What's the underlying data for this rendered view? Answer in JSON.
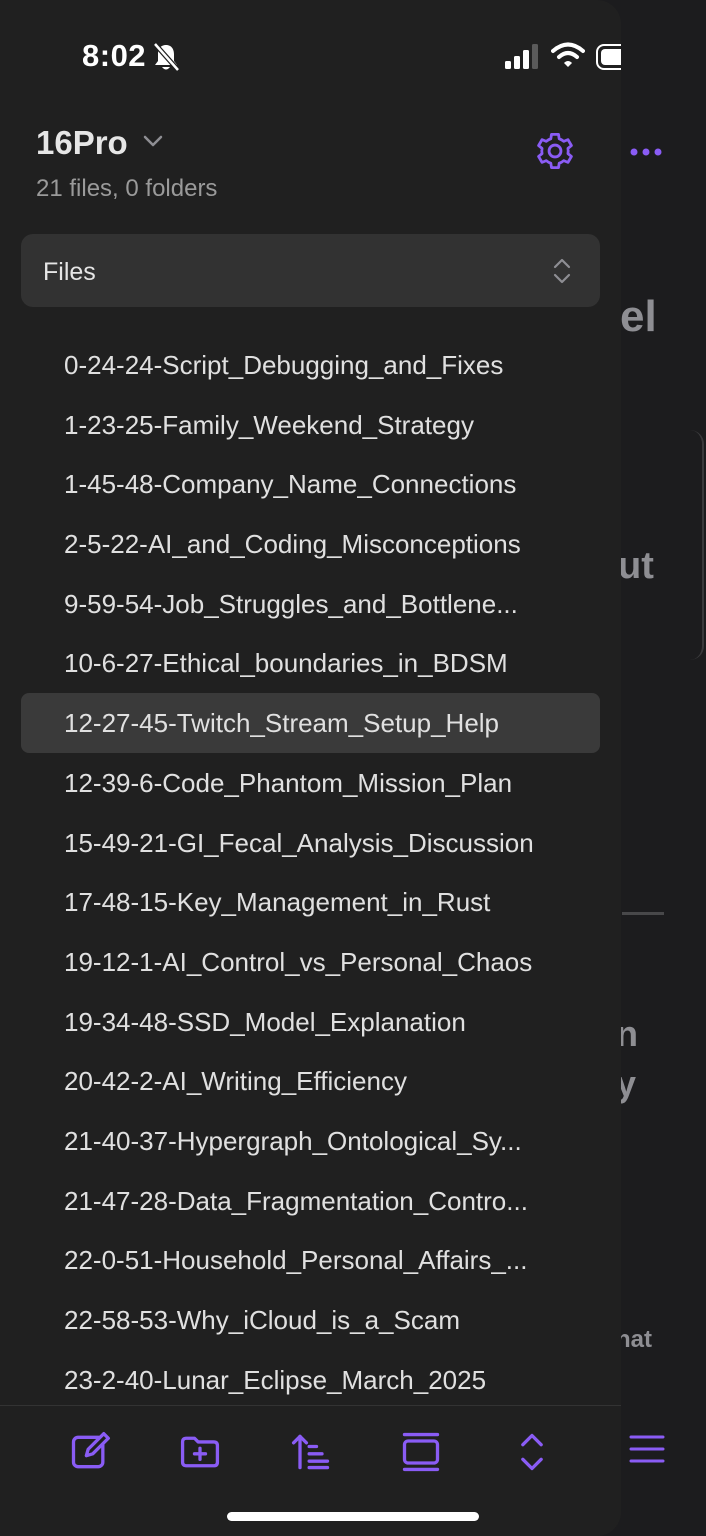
{
  "status_bar": {
    "time": "8:02"
  },
  "sidebar": {
    "vault_name": "16Pro",
    "vault_count": "21 files, 0 folders",
    "selector_label": "Files",
    "files": [
      "0-24-24-Script_Debugging_and_Fixes",
      "1-23-25-Family_Weekend_Strategy",
      "1-45-48-Company_Name_Connections",
      "2-5-22-AI_and_Coding_Misconceptions",
      "9-59-54-Job_Struggles_and_Bottlene...",
      "10-6-27-Ethical_boundaries_in_BDSM",
      "12-27-45-Twitch_Stream_Setup_Help",
      "12-39-6-Code_Phantom_Mission_Plan",
      "15-49-21-GI_Fecal_Analysis_Discussion",
      "17-48-15-Key_Management_in_Rust",
      "19-12-1-AI_Control_vs_Personal_Chaos",
      "19-34-48-SSD_Model_Explanation",
      "20-42-2-AI_Writing_Efficiency",
      "21-40-37-Hypergraph_Ontological_Sy...",
      "21-47-28-Data_Fragmentation_Contro...",
      "22-0-51-Household_Personal_Affairs_...",
      "22-58-53-Why_iCloud_is_a_Scam",
      "23-2-40-Lunar_Eclipse_March_2025"
    ],
    "active_index": 6
  },
  "background_fragments": {
    "f1": "el",
    "f2": "ut",
    "f3": "n",
    "f4": "y",
    "f5": "hat"
  },
  "colors": {
    "accent": "#8a5cf5",
    "panel": "#202020",
    "selected": "#3a3a3a"
  },
  "icons": {
    "settings": "gear-icon",
    "toolbar": [
      "new-note-icon",
      "new-folder-icon",
      "sort-icon",
      "collapse-icon",
      "expand-icon"
    ],
    "more": "more-dots-icon",
    "menu": "hamburger-menu-icon"
  }
}
